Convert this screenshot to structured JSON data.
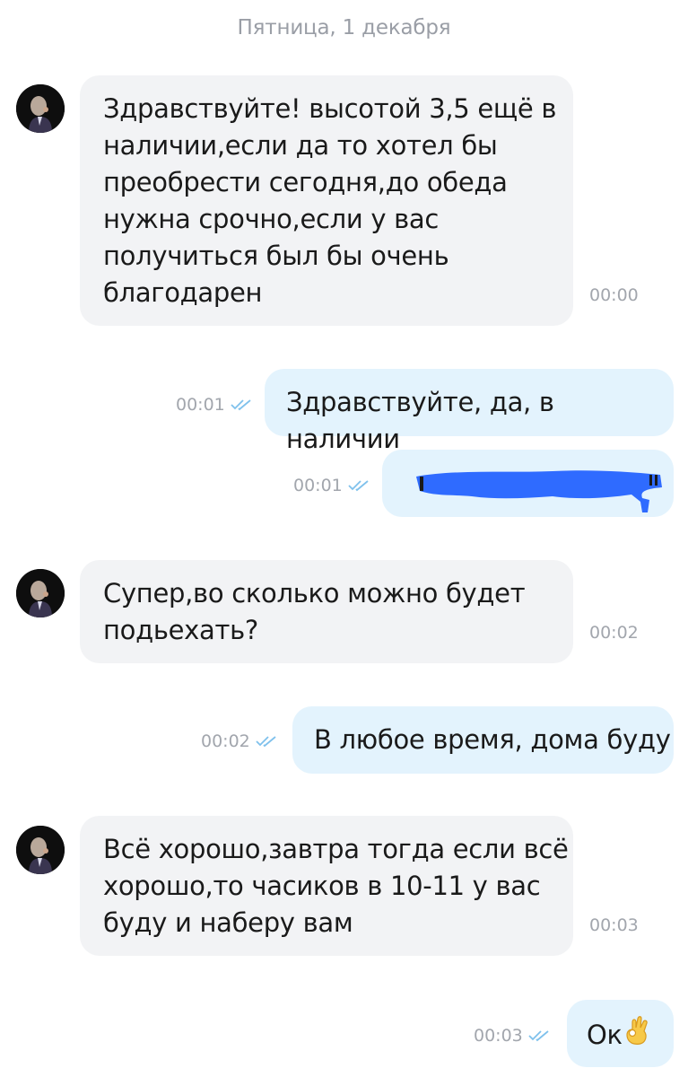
{
  "date_header": "Пятница, 1 декабря",
  "messages": [
    {
      "direction": "incoming",
      "lines": [
        "Здравствуйте! высотой 3,5 ещё в",
        "наличии,если да то хотел бы",
        "преобрести сегодня,до обеда",
        "нужна срочно,если у вас",
        "получиться был бы очень",
        "благодарен"
      ],
      "time": "00:00"
    },
    {
      "direction": "outgoing",
      "text": "Здравствуйте, да, в наличии",
      "time": "00:01",
      "status": "read"
    },
    {
      "direction": "outgoing",
      "text": "",
      "redacted": true,
      "time": "00:01",
      "status": "read"
    },
    {
      "direction": "incoming",
      "lines": [
        "Супер,во сколько можно будет",
        "подьехать?"
      ],
      "time": "00:02"
    },
    {
      "direction": "outgoing",
      "text": "В любое время, дома буду",
      "time": "00:02",
      "status": "read"
    },
    {
      "direction": "incoming",
      "lines": [
        "Всё хорошо,завтра тогда если всё",
        "хорошо,то часиков в 10-11 у вас",
        "буду и наберу вам"
      ],
      "time": "00:03"
    },
    {
      "direction": "outgoing",
      "text": "Ок",
      "emoji": "ok-hand",
      "time": "00:03",
      "status": "read"
    }
  ],
  "colors": {
    "incoming_bubble": "#f2f3f5",
    "outgoing_bubble": "#e3f3fd",
    "read_check": "#7fc1ec",
    "redaction": "#2f6bff"
  },
  "icons": {
    "read_status": "double-check-icon",
    "avatar": "user-avatar"
  }
}
